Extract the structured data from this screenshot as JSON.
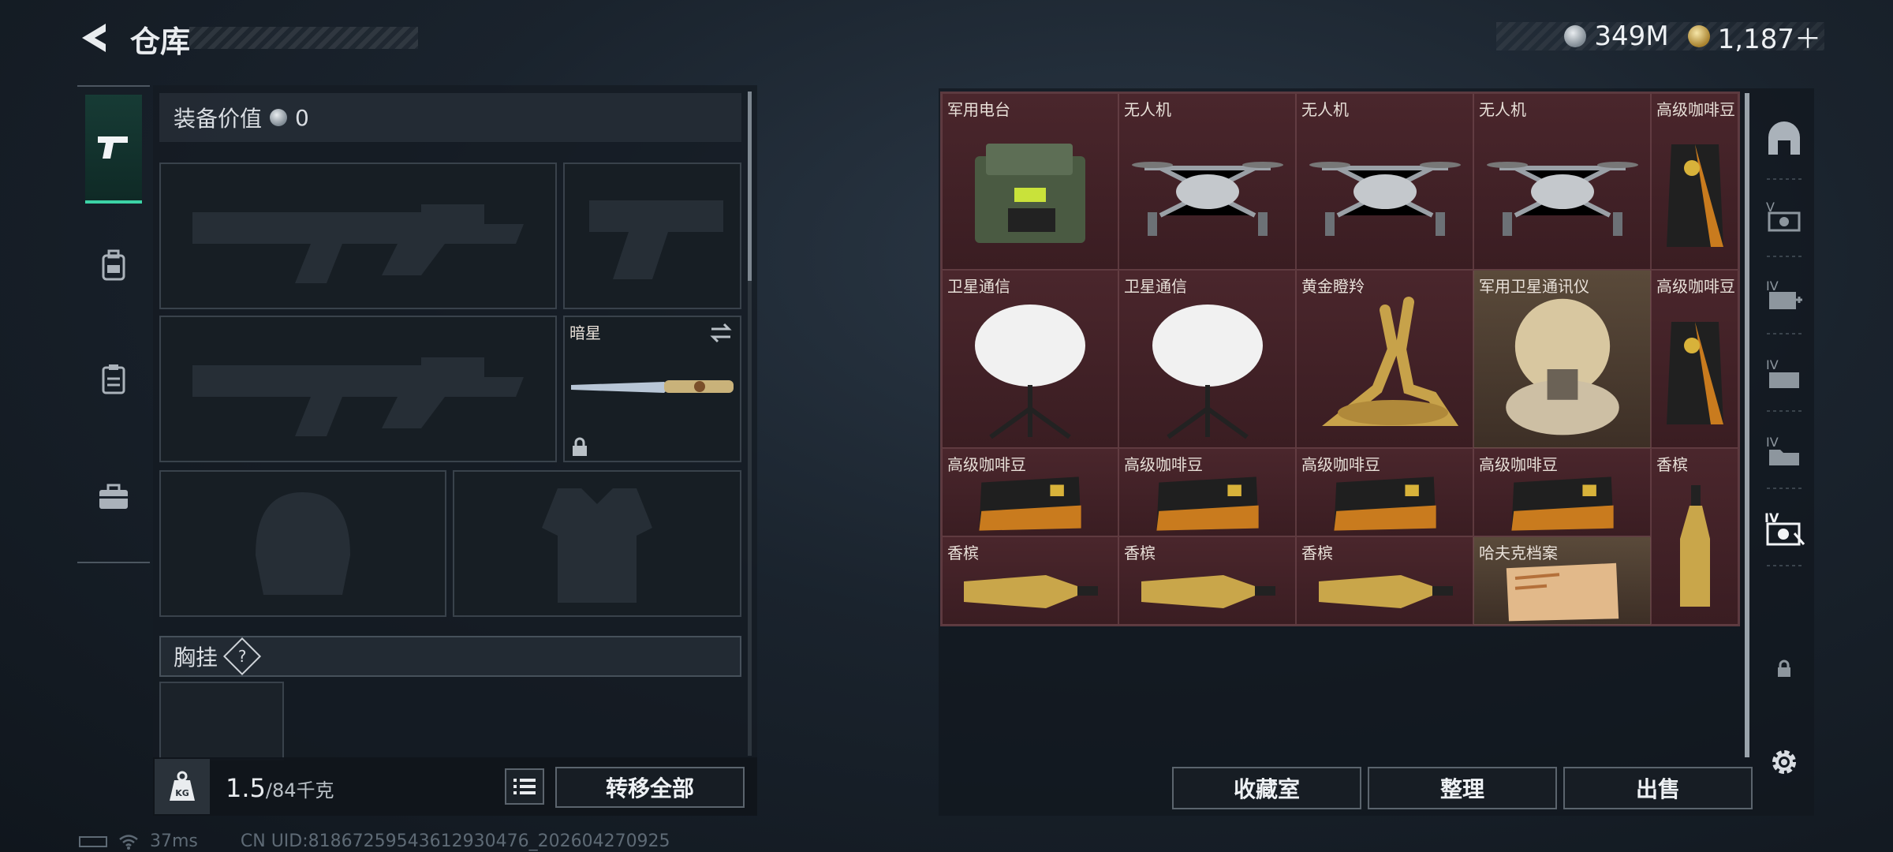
{
  "header": {
    "title": "仓库",
    "silver": "349M",
    "gold": "1,187＋"
  },
  "loadout": {
    "equip_value_label": "装备价值",
    "equip_value": "0",
    "melee_name": "暗星",
    "chest_label": "胸挂",
    "help": "?"
  },
  "footer": {
    "weight_current": "1.5",
    "weight_max": "/84千克",
    "weight_icon_label": "KG",
    "transfer_all": "转移全部",
    "collection": "收藏室",
    "organize": "整理",
    "sell": "出售"
  },
  "status": {
    "ping": "37ms",
    "uid": "CN UID:8186725954361293047​6_202604270925"
  },
  "stash_items": [
    {
      "label": "军用电台",
      "icon": "radio"
    },
    {
      "label": "无人机",
      "icon": "drone"
    },
    {
      "label": "无人机",
      "icon": "drone"
    },
    {
      "label": "无人机",
      "icon": "drone"
    },
    {
      "label": "高级咖啡豆",
      "icon": "coffee-tall"
    },
    {
      "label": "卫星通信",
      "icon": "satellite-dish"
    },
    {
      "label": "卫星通信",
      "icon": "satellite-dish"
    },
    {
      "label": "黄金瞪羚",
      "icon": "golden-gazelle"
    },
    {
      "label": "军用卫星通讯仪",
      "icon": "sat-comm"
    },
    {
      "label": "高级咖啡豆",
      "icon": "coffee-tall"
    },
    {
      "label": "高级咖啡豆",
      "icon": "coffee-flat"
    },
    {
      "label": "高级咖啡豆",
      "icon": "coffee-flat"
    },
    {
      "label": "高级咖啡豆",
      "icon": "coffee-flat"
    },
    {
      "label": "高级咖啡豆",
      "icon": "coffee-flat"
    },
    {
      "label": "香槟",
      "icon": "champagne-upright"
    },
    {
      "label": "香槟",
      "icon": "champagne"
    },
    {
      "label": "香槟",
      "icon": "champagne"
    },
    {
      "label": "香槟",
      "icon": "champagne"
    },
    {
      "label": "哈夫克档案",
      "icon": "dossier"
    }
  ],
  "colors": {
    "accent": "#3cd3a6",
    "stash_bg": "#3e1f25",
    "gold_bg": "#5a4a3a"
  }
}
